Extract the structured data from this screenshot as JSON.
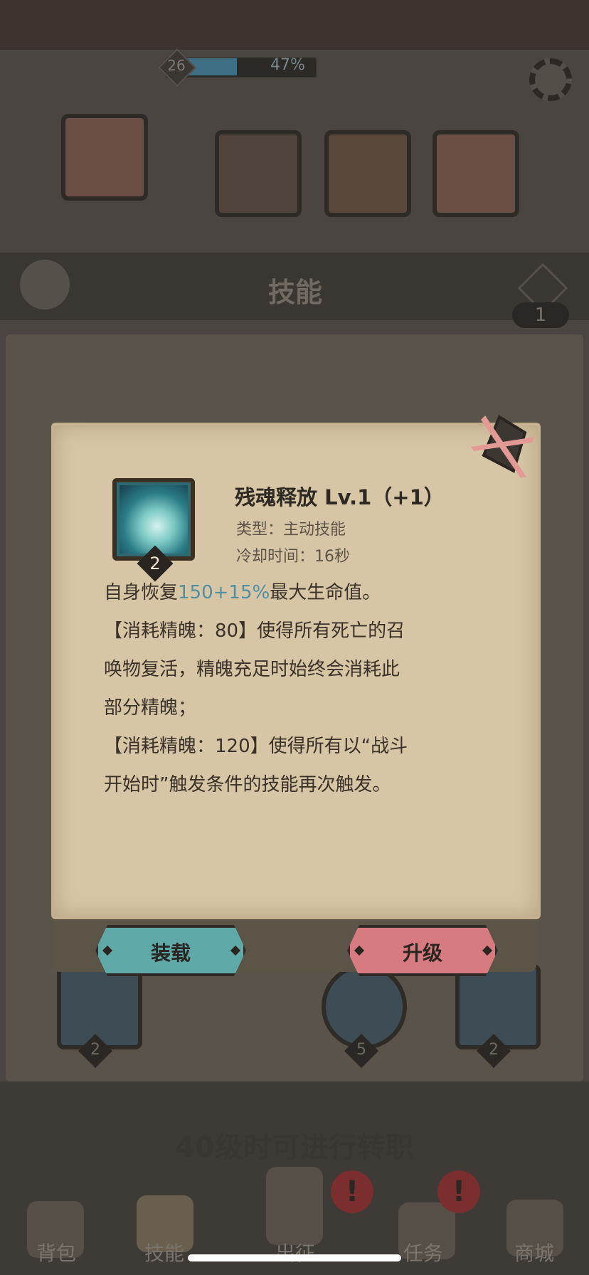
{
  "header": {
    "player_level": "26",
    "xp_percent": "47%",
    "xp_fraction": 0.47
  },
  "banner": {
    "title": "技能",
    "badge_count": "1"
  },
  "background": {
    "slot_numbers": [
      "2",
      "5",
      "2"
    ],
    "transfer_notice": "40级时可进行转职"
  },
  "nav": [
    {
      "label": "背包",
      "icon": "backpack-icon"
    },
    {
      "label": "技能",
      "icon": "skill-book-icon"
    },
    {
      "label": "出征",
      "icon": "sword-icon"
    },
    {
      "label": "任务",
      "icon": "quest-scroll-icon"
    },
    {
      "label": "商城",
      "icon": "shop-icon"
    }
  ],
  "modal": {
    "skill_name": "残魂释放  Lv.1（+1）",
    "type_line": "类型：主动技能",
    "cooldown_line": "冷却时间：16秒",
    "icon_level": "2",
    "description_partial_top": "自身恢复",
    "description_partial_highlight": "150+15%",
    "description_partial_rest": "最大生命值。",
    "description_lines": [
      "【消耗精魄：80】使得所有死亡的召",
      "唤物复活，精魄充足时始终会消耗此",
      "部分精魄；",
      "【消耗精魄：120】使得所有以“战斗",
      "开始时”触发条件的技能再次触发。"
    ],
    "equip_label": "装载",
    "upgrade_label": "升级",
    "colors": {
      "equip": "#5fa9a9",
      "upgrade": "#d77b80",
      "paper": "#d6c6a6"
    }
  }
}
